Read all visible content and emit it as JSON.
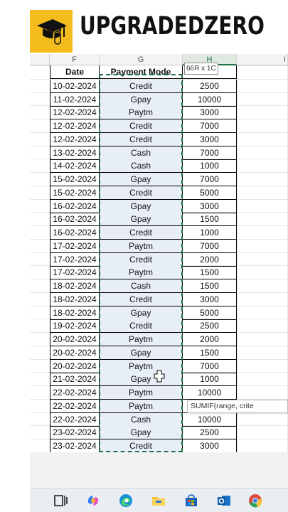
{
  "brand": {
    "name": "UPGRADEDZERO"
  },
  "columns": [
    {
      "id": "F",
      "label": "F"
    },
    {
      "id": "G",
      "label": "G"
    },
    {
      "id": "H",
      "label": "H"
    },
    {
      "id": "I",
      "label": "I"
    }
  ],
  "table": {
    "headers": {
      "date": "Date",
      "mode": "Payment Mode",
      "amount": "nt"
    },
    "rows": [
      {
        "date": "10-02-2024",
        "mode": "Credit",
        "amount": "2500"
      },
      {
        "date": "11-02-2024",
        "mode": "Gpay",
        "amount": "10000"
      },
      {
        "date": "12-02-2024",
        "mode": "Paytm",
        "amount": "3000"
      },
      {
        "date": "12-02-2024",
        "mode": "Credit",
        "amount": "7000"
      },
      {
        "date": "12-02-2024",
        "mode": "Credit",
        "amount": "3000"
      },
      {
        "date": "13-02-2024",
        "mode": "Cash",
        "amount": "7000"
      },
      {
        "date": "14-02-2024",
        "mode": "Cash",
        "amount": "1000"
      },
      {
        "date": "15-02-2024",
        "mode": "Gpay",
        "amount": "7000"
      },
      {
        "date": "15-02-2024",
        "mode": "Credit",
        "amount": "5000"
      },
      {
        "date": "16-02-2024",
        "mode": "Gpay",
        "amount": "3000"
      },
      {
        "date": "16-02-2024",
        "mode": "Gpay",
        "amount": "1500"
      },
      {
        "date": "16-02-2024",
        "mode": "Credit",
        "amount": "1000"
      },
      {
        "date": "17-02-2024",
        "mode": "Paytm",
        "amount": "7000"
      },
      {
        "date": "17-02-2024",
        "mode": "Credit",
        "amount": "2000"
      },
      {
        "date": "17-02-2024",
        "mode": "Paytm",
        "amount": "1500"
      },
      {
        "date": "18-02-2024",
        "mode": "Cash",
        "amount": "1500"
      },
      {
        "date": "18-02-2024",
        "mode": "Credit",
        "amount": "3000"
      },
      {
        "date": "18-02-2024",
        "mode": "Gpay",
        "amount": "5000"
      },
      {
        "date": "19-02-2024",
        "mode": "Credit",
        "amount": "2500"
      },
      {
        "date": "20-02-2024",
        "mode": "Paytm",
        "amount": "2000"
      },
      {
        "date": "20-02-2024",
        "mode": "Gpay",
        "amount": "1500"
      },
      {
        "date": "20-02-2024",
        "mode": "Paytm",
        "amount": "7000"
      },
      {
        "date": "21-02-2024",
        "mode": "Gpay",
        "amount": "1000"
      },
      {
        "date": "22-02-2024",
        "mode": "Paytm",
        "amount": "10000"
      },
      {
        "date": "22-02-2024",
        "mode": "Paytm",
        "amount": ""
      },
      {
        "date": "22-02-2024",
        "mode": "Cash",
        "amount": "10000"
      },
      {
        "date": "23-02-2024",
        "mode": "Gpay",
        "amount": "2500"
      },
      {
        "date": "23-02-2024",
        "mode": "Credit",
        "amount": "3000"
      }
    ]
  },
  "selection_tooltip": "66R x 1C",
  "function_tooltip": "SUMIF(range, crite",
  "colors": {
    "accent": "#217346",
    "logo": "#f4bc1c",
    "selection_fill": "#e8eef8"
  },
  "taskbar": {
    "icons": [
      "task-view-icon",
      "copilot-icon",
      "edge-icon",
      "file-explorer-icon",
      "store-icon",
      "outlook-icon",
      "chrome-icon"
    ]
  }
}
